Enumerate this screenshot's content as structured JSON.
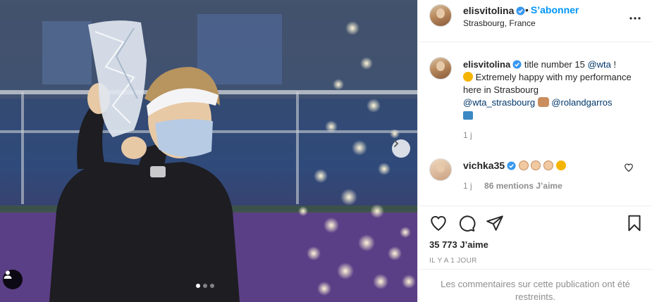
{
  "post": {
    "username": "elisvitolina",
    "follow_label": "S’abonner",
    "location": "Strasbourg, France",
    "caption": {
      "username": "elisvitolina",
      "text_1": "title number 15",
      "mention_wta": "@wta",
      "text_2": "!",
      "text_3": "Extremely happy with my performance here in Strasbourg",
      "mention_wta_strasbourg": "@wta_strasbourg",
      "mention_rolandgarros": "@rolandgarros",
      "time": "1 j"
    },
    "comment": {
      "username": "vichka35",
      "time": "1 j",
      "likes": "86 mentions J’aime"
    },
    "likes_count": "35 773 J’aime",
    "date": "IL Y A 1 JOUR",
    "restricted_notice": "Les commentaires sur cette publication ont été restreints."
  },
  "carousel": {
    "total": 3,
    "active_index": 0
  },
  "icons": {
    "verified": "verified-badge-icon",
    "more": "more-options-icon",
    "like": "heart-icon",
    "comment": "comment-icon",
    "share": "share-icon",
    "save": "bookmark-icon",
    "next": "chevron-right-icon",
    "tag": "user-tag-icon"
  },
  "colors": {
    "accent": "#0095f6",
    "verified": "#3897f0",
    "text": "#262626",
    "muted": "#8e8e8e"
  }
}
